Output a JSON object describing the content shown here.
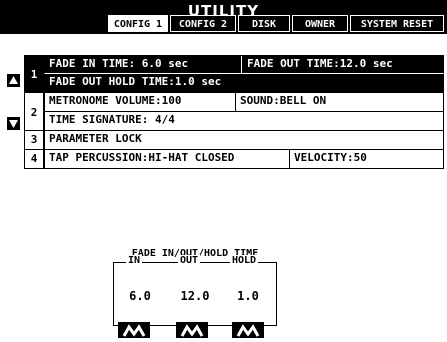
{
  "window": {
    "title": "UTILITY"
  },
  "tabs": [
    {
      "label": "CONFIG 1",
      "active": true
    },
    {
      "label": "CONFIG 2",
      "active": false
    },
    {
      "label": "DISK",
      "active": false
    },
    {
      "label": "OWNER",
      "active": false
    },
    {
      "label": "SYSTEM RESET",
      "active": false
    }
  ],
  "rows": [
    {
      "num": "1",
      "lines": [
        {
          "cells": [
            "FADE IN TIME: 6.0 sec",
            "FADE OUT TIME:12.0 sec"
          ]
        },
        {
          "cells": [
            "FADE OUT HOLD TIME:1.0 sec"
          ]
        }
      ],
      "selected": true
    },
    {
      "num": "2",
      "lines": [
        {
          "cells": [
            "METRONOME VOLUME:100",
            "SOUND:BELL ON"
          ]
        },
        {
          "cells": [
            "TIME SIGNATURE:  4/4"
          ]
        }
      ]
    },
    {
      "num": "3",
      "lines": [
        {
          "cells": [
            "PARAMETER LOCK"
          ]
        }
      ]
    },
    {
      "num": "4",
      "lines": [
        {
          "cells": [
            "TAP PERCUSSION:HI-HAT CLOSED",
            "VELOCITY:50"
          ]
        }
      ]
    }
  ],
  "fade_panel": {
    "title": "FADE IN/OUT/HOLD TIME",
    "headers": [
      "IN",
      "OUT",
      "HOLD"
    ],
    "values": [
      "6.0",
      "12.0",
      "1.0"
    ]
  },
  "icons": {
    "up": "triangle-up-icon",
    "down": "triangle-down-icon"
  },
  "colors": {
    "fg": "#000000",
    "bg": "#ffffff"
  }
}
